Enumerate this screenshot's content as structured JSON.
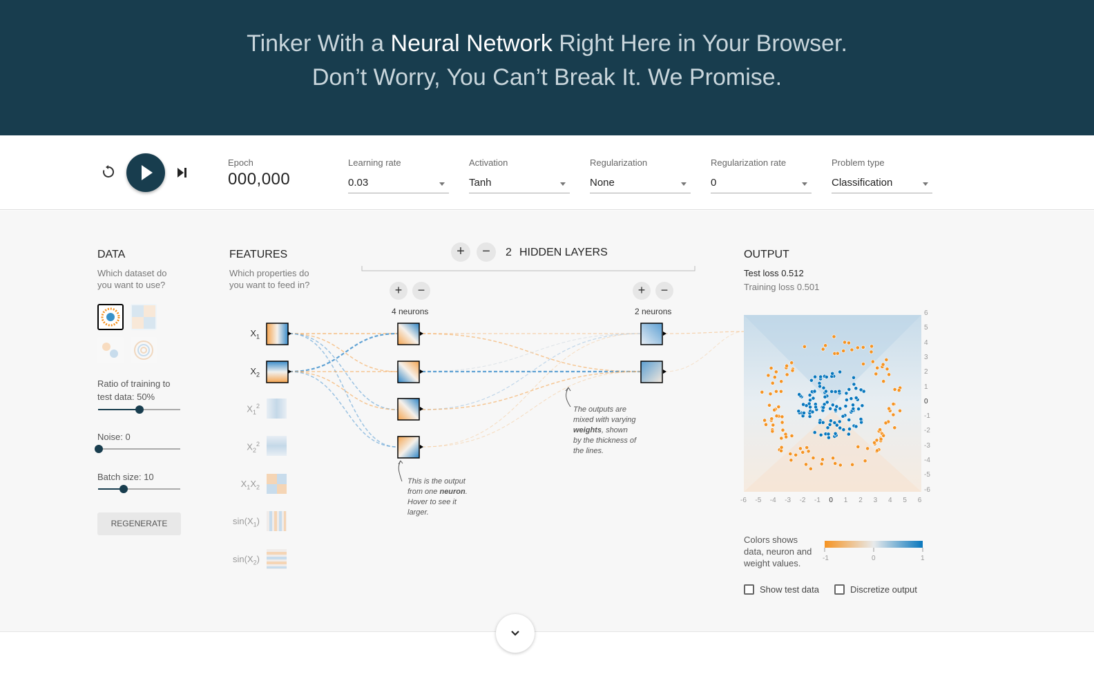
{
  "header": {
    "line1_pre": "Tinker With a ",
    "line1_bold": "Neural Network",
    "line1_post": " Right Here in Your Browser.",
    "line2": "Don’t Worry, You Can’t Break It. We Promise."
  },
  "controls": {
    "reset_icon": "reset-icon",
    "play_icon": "play-icon",
    "step_icon": "step-forward-icon",
    "epoch_label": "Epoch",
    "epoch_value": "000,000",
    "learning_rate_label": "Learning rate",
    "learning_rate_value": "0.03",
    "activation_label": "Activation",
    "activation_value": "Tanh",
    "regularization_label": "Regularization",
    "regularization_value": "None",
    "reg_rate_label": "Regularization rate",
    "reg_rate_value": "0",
    "problem_type_label": "Problem type",
    "problem_type_value": "Classification"
  },
  "data_panel": {
    "title": "DATA",
    "subtitle_1": "Which dataset do",
    "subtitle_2": "you want to use?",
    "ratio_label": "Ratio of training to",
    "ratio_label_2": "test data:  50%",
    "ratio_value": 0.5,
    "noise_label": "Noise:  0",
    "noise_value": 0,
    "batch_label": "Batch size:  10",
    "batch_value": 0.3,
    "regenerate_label": "REGENERATE"
  },
  "features_panel": {
    "title": "FEATURES",
    "subtitle_1": "Which properties do",
    "subtitle_2": "you want to feed in?"
  },
  "network": {
    "hidden_count": "2",
    "hidden_label": "HIDDEN LAYERS",
    "layer1_neurons": "4 neurons",
    "layer2_neurons": "2 neurons",
    "note_neuron_1": "This is the output",
    "note_neuron_2_pre": "from one ",
    "note_neuron_2_bold": "neuron",
    "note_neuron_2_post": ".",
    "note_neuron_3": "Hover to see it",
    "note_neuron_4": "larger.",
    "note_weights_1": "The outputs are",
    "note_weights_2": "mixed with varying",
    "note_weights_3_bold": "weights",
    "note_weights_3_post": ", shown",
    "note_weights_4": "by the thickness of",
    "note_weights_5": "the lines."
  },
  "output_panel": {
    "title": "OUTPUT",
    "test_loss_label": "Test loss",
    "test_loss_value": "0.512",
    "training_loss_label": "Training loss",
    "training_loss_value": "0.501",
    "y_ticks": [
      "6",
      "5",
      "4",
      "3",
      "2",
      "1",
      "0",
      "-1",
      "-2",
      "-3",
      "-4",
      "-5",
      "-6"
    ],
    "x_ticks": [
      "-6",
      "-5",
      "-4",
      "-3",
      "-2",
      "-1",
      "0",
      "1",
      "2",
      "3",
      "4",
      "5",
      "6"
    ],
    "legend_text_1": "Colors shows",
    "legend_text_2": "data, neuron and",
    "legend_text_3": "weight values.",
    "legend_min": "-1",
    "legend_mid": "0",
    "legend_max": "1",
    "show_test_label": "Show test data",
    "discretize_label": "Discretize output"
  },
  "colors": {
    "header_bg": "#183d4e",
    "orange": "#f59322",
    "blue": "#0877bd"
  }
}
